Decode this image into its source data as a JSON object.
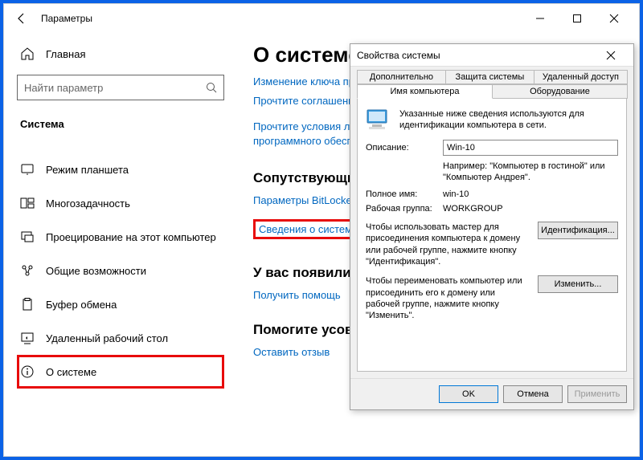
{
  "settings": {
    "title": "Параметры",
    "search_placeholder": "Найти параметр",
    "home": "Главная",
    "category": "Система",
    "nav": [
      {
        "label": "Режим планшета"
      },
      {
        "label": "Многозадачность"
      },
      {
        "label": "Проецирование на этот компьютер"
      },
      {
        "label": "Общие возможности"
      },
      {
        "label": "Буфер обмена"
      },
      {
        "label": "Удаленный рабочий стол"
      },
      {
        "label": "О системе"
      }
    ]
  },
  "content": {
    "heading": "О системе",
    "links_top": [
      "Изменение ключа продукта",
      "Прочтите соглашение о лицензии, которое применяется к...",
      "Прочтите условия лицензионного соглашения на использование программного обеспечения"
    ],
    "related_heading": "Сопутствующие параметры",
    "related_links": [
      "Параметры BitLocker",
      "Сведения о системе"
    ],
    "help_heading": "У вас появились вопросы?",
    "help_link": "Получить помощь",
    "improve_heading": "Помогите усовершенствовать Windows",
    "improve_link": "Оставить отзыв"
  },
  "dialog": {
    "title": "Свойства системы",
    "tabs_row1": [
      "Дополнительно",
      "Защита системы",
      "Удаленный доступ"
    ],
    "tabs_row2": [
      "Имя компьютера",
      "Оборудование"
    ],
    "info_text": "Указанные ниже сведения используются для идентификации компьютера в сети.",
    "desc_label": "Описание:",
    "desc_value": "Win-10",
    "example": "Например: \"Компьютер в гостиной\" или \"Компьютер Андрея\".",
    "fullname_label": "Полное имя:",
    "fullname_value": "win-10",
    "workgroup_label": "Рабочая группа:",
    "workgroup_value": "WORKGROUP",
    "wizard1_text": "Чтобы использовать мастер для присоединения компьютера к домену или рабочей группе, нажмите кнопку \"Идентификация\".",
    "wizard1_btn": "Идентификация...",
    "wizard2_text": "Чтобы переименовать компьютер или присоединить его к домену или рабочей группе, нажмите кнопку \"Изменить\".",
    "wizard2_btn": "Изменить...",
    "ok": "OK",
    "cancel": "Отмена",
    "apply": "Применить"
  }
}
